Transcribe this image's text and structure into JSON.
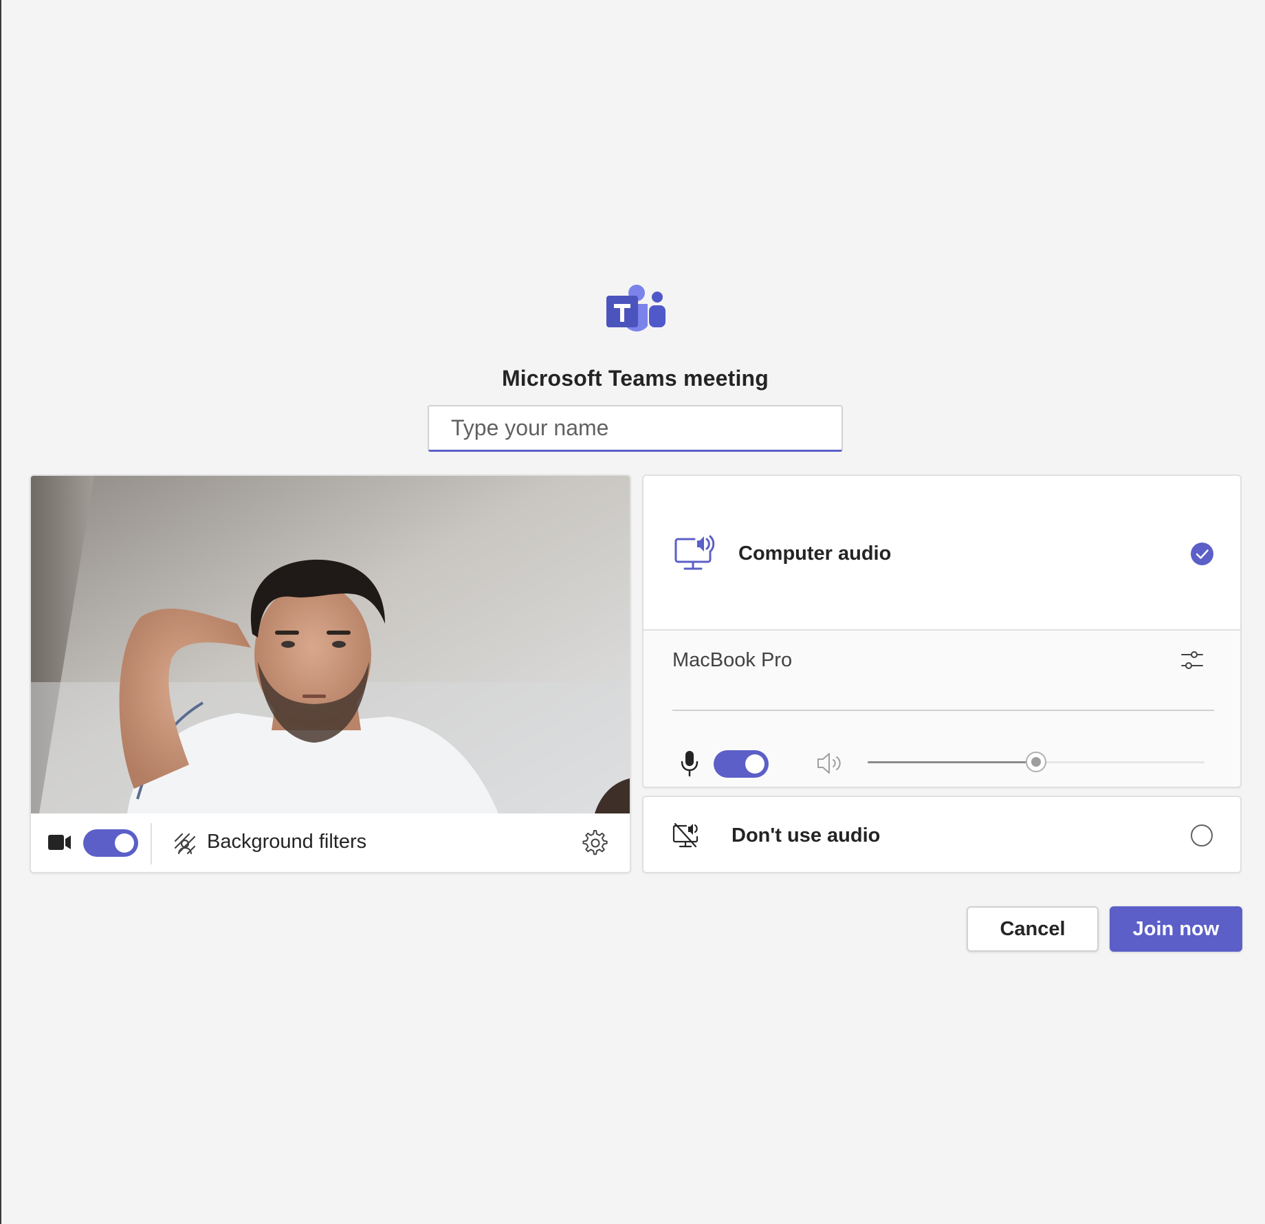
{
  "meeting": {
    "title": "Microsoft Teams meeting"
  },
  "name_input": {
    "placeholder": "Type your name",
    "value": ""
  },
  "video": {
    "camera_on": true,
    "background_filters_label": "Background filters"
  },
  "audio": {
    "computer_audio_label": "Computer audio",
    "computer_audio_selected": true,
    "device_name": "MacBook Pro",
    "mic_on": true,
    "speaker_volume_percent": 50,
    "dont_use_audio_label": "Don't use audio",
    "dont_use_audio_selected": false
  },
  "actions": {
    "cancel_label": "Cancel",
    "join_label": "Join now"
  },
  "colors": {
    "accent": "#5b5fc7",
    "background": "#f4f4f4"
  },
  "icons": [
    "teams-logo-icon",
    "camera-icon",
    "background-filters-icon",
    "settings-gear-icon",
    "computer-audio-icon",
    "checkmark-icon",
    "device-settings-icon",
    "microphone-icon",
    "speaker-icon",
    "no-audio-icon"
  ]
}
